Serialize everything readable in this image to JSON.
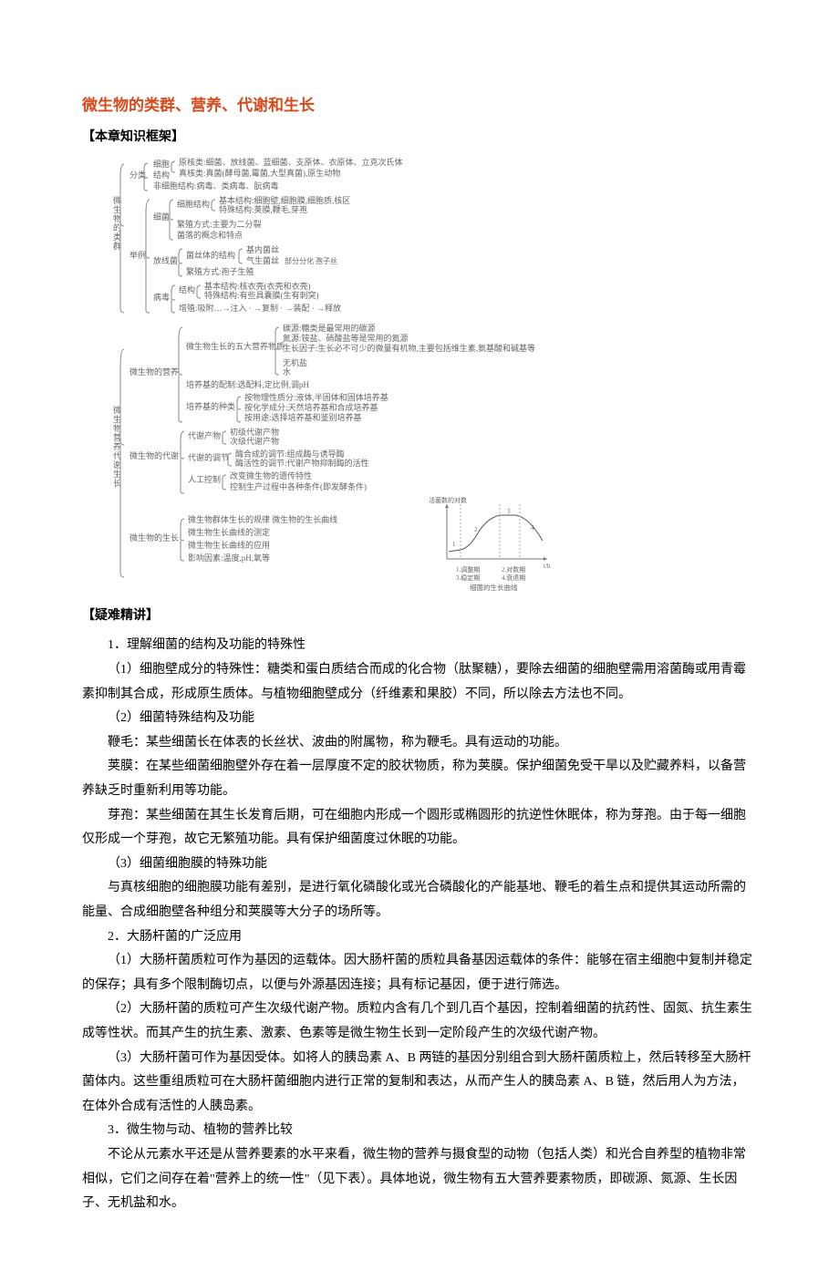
{
  "title": "微生物的类群、营养、代谢和生长",
  "section1": "【本章知识框架】",
  "section2": "【疑难精讲】",
  "diagram": {
    "sideLabel1": "微生物的类群",
    "sideLabel2": "微生物营养代谢生长",
    "branches": {
      "a": "分类",
      "a1": "细胞",
      "a1t": "原核类:细菌、放线菌、蓝细菌、支原体、衣原体、立克次氏体",
      "a2": "结构",
      "a2t": "真核类:真菌(酵母菌,霉菌,大型真菌),原生动物",
      "a3": "非细胞结构:病毒、类病毒、朊病毒",
      "b": "举例",
      "b1": "细菌",
      "b1a": "细胞结构",
      "b1a1": "基本结构:细胞壁,细胞膜,细胞质,核区",
      "b1a2": "特殊结构:荚膜,鞭毛,芽孢",
      "b1b": "繁殖方式:主要为二分裂",
      "b1c": "菌落的概念和特点",
      "b2": "放线菌",
      "b2a": "菌丝体的结构",
      "b2a1": "基内菌丝",
      "b2a2": "气生菌丝",
      "b2a2x": "部分分化 孢子丝",
      "b2b": "繁殖方式:孢子生殖",
      "b3": "病毒",
      "b3a": "结构",
      "b3a1": "基本结构:核衣壳(衣壳和衣壳)",
      "b3a2": "特殊结构:有些具囊膜(生有刺突)",
      "b3b": "增殖:吸附…→注入 · →复制 · →装配 · →释放",
      "c1": "微生物的营养",
      "c1a": "微生物生长的五大营养物质",
      "c1a1": "碳源:糖类是最常用的碳源",
      "c1a2": "氮源:铵盐、硝酸盐等是常用的氮源",
      "c1a3": "生长因子:生长必不可少的微量有机物,主要包括维生素,氨基酸和碱基等",
      "c1a4": "无机盐",
      "c1a5": "水",
      "c1b": "培养基的配制:选配料,定比例,调pH",
      "c1c": "培养基的种类",
      "c1c1": "按物理性质分:液体,半固体和固体培养基",
      "c1c2": "按化学成分:天然培养基和合成培养基",
      "c1c3": "按用途:选择培养基和鉴别培养基",
      "c2": "微生物的代谢",
      "c2a": "代谢产物",
      "c2a1": "初级代谢产物",
      "c2a2": "次级代谢产物",
      "c2b": "代谢的调节",
      "c2b1": "酶合成的调节:组成酶与诱导酶",
      "c2b2": "酶活性的调节:代谢产物抑制酶的活性",
      "c2c": "人工控制",
      "c2c1": "改变微生物的遗传特性",
      "c2c2": "控制生产过程中各种条件(即发酵条件)",
      "c3": "微生物的生长",
      "c3a": "微生物群体生长的规律  微生物的生长曲线",
      "c3b": "微生物生长曲线的测定",
      "c3c": "微生物生长曲线的应用",
      "c3d": "影响因素:温度,pH,氧等"
    },
    "chart": {
      "yAxis": "活菌数的对数",
      "xAxis": "t/h",
      "legend": [
        "1.调整期",
        "2.对数期",
        "3.稳定期",
        "4.衰退期"
      ],
      "caption": "细菌的生长曲线"
    }
  },
  "body": {
    "h1": "1．理解细菌的结构及功能的特殊性",
    "p1": "（1）细胞壁成分的特殊性：糖类和蛋白质结合而成的化合物（肽聚糖），要除去细菌的细胞壁需用溶菌酶或用青霉素抑制其合成，形成原生质体。与植物细胞壁成分（纤维素和果胶）不同，所以除去方法也不同。",
    "p2": "（2）细菌特殊结构及功能",
    "p3": "鞭毛：某些细菌长在体表的长丝状、波曲的附属物，称为鞭毛。具有运动的功能。",
    "p4": "荚膜：在某些细菌细胞壁外存在着一层厚度不定的胶状物质，称为荚膜。保护细菌免受干旱以及贮藏养料，以备营养缺乏时重新利用等功能。",
    "p5": "芽孢：某些细菌在其生长发育后期，可在细胞内形成一个圆形或椭圆形的抗逆性休眠体，称为芽孢。由于每一细胞仅形成一个芽孢，故它无繁殖功能。具有保护细菌度过休眠的功能。",
    "p6": "（3）细菌细胞膜的特殊功能",
    "p7": "与真核细胞的细胞膜功能有差别，是进行氧化磷酸化或光合磷酸化的产能基地、鞭毛的着生点和提供其运动所需的能量、合成细胞壁各种组分和荚膜等大分子的场所等。",
    "h2": "2．大肠杆菌的广泛应用",
    "p8": "（1）大肠杆菌质粒可作为基因的运载体。因大肠杆菌的质粒具备基因运载体的条件：能够在宿主细胞中复制并稳定的保存；具有多个限制酶切点，以便与外源基因连接；具有标记基因，便于进行筛选。",
    "p9": "（2）大肠杆菌的质粒可产生次级代谢产物。质粒内含有几个到几百个基因，控制着细菌的抗药性、固氮、抗生素生成等性状。而其产生的抗生素、激素、色素等是微生物生长到一定阶段产生的次级代谢产物。",
    "p10": "（3）大肠杆菌可作为基因受体。如将人的胰岛素 A、B 两链的基因分别组合到大肠杆菌质粒上，然后转移至大肠杆菌体内。这些重组质粒可在大肠杆菌细胞内进行正常的复制和表达，从而产生人的胰岛素 A、B 链，然后用人为方法，在体外合成有活性的人胰岛素。",
    "h3": "3．微生物与动、植物的营养比较",
    "p11": "不论从元素水平还是从营养要素的水平来看，微生物的营养与摄食型的动物（包括人类）和光合自养型的植物非常相似，它们之间存在着\"营养上的统一性\"（见下表）。具体地说，微生物有五大营养要素物质，即碳源、氮源、生长因子、无机盐和水。"
  }
}
